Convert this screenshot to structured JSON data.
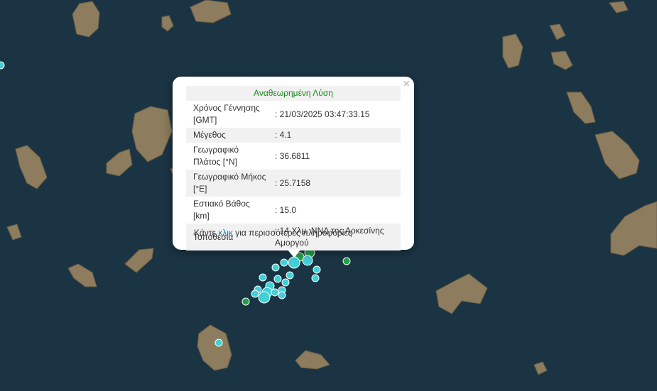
{
  "popup": {
    "title": "Αναθεωρημένη Λύση",
    "close_symbol": "×",
    "rows": [
      {
        "label": "Χρόνος Γέννησης [GMT]",
        "value": ": 21/03/2025 03:47:33.15"
      },
      {
        "label": "Μέγεθος",
        "value": ": 4.1"
      },
      {
        "label": "Γεωγραφικό Πλάτος [°N]",
        "value": ": 36.6811"
      },
      {
        "label": "Γεωγραφικό Μήκος [°E]",
        "value": ": 25.7158"
      },
      {
        "label": "Εστιακό Βάθος [km]",
        "value": ": 15.0"
      },
      {
        "label": "Τοποθεσία",
        "value": ": 14 Χλμ. ΝΝΔ της Αρκεσίνης Αμοργού"
      }
    ],
    "more_prefix": "Κάντε ",
    "more_link": "κλικ",
    "more_suffix": " για περισσότερες πληροφορίες"
  },
  "colors": {
    "sea": "#1a3342",
    "land": "#8a7a5e",
    "quake_cyan": "#3fd0d8",
    "quake_green": "#22a04a",
    "title_green": "#1a8a1a",
    "link_blue": "#1b7bb8"
  }
}
